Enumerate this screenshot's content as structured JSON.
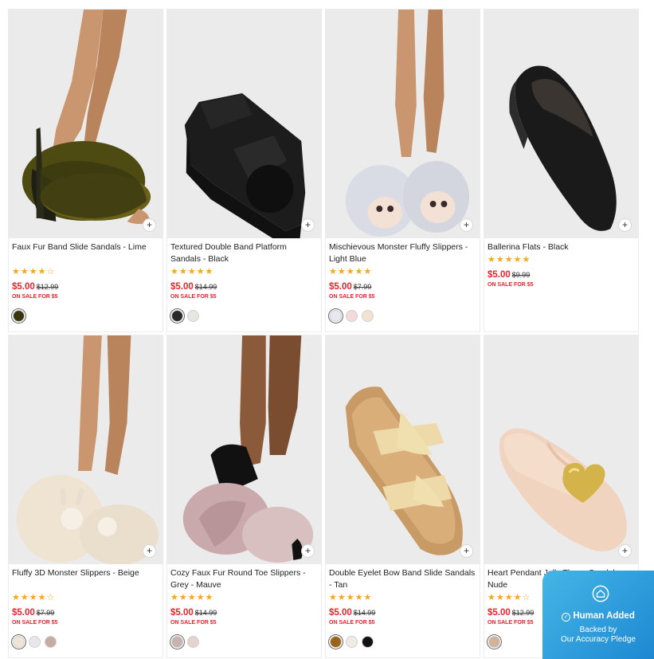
{
  "products": [
    {
      "name": "Faux Fur Band Slide Sandals - Lime",
      "rating": "★★★★☆",
      "price": "$5.00",
      "was": "$12.99",
      "sale": "ON SALE FOR $5",
      "swatches": [
        "#3a3410"
      ],
      "img": "furslide"
    },
    {
      "name": "Textured Double Band Platform Sandals - Black",
      "rating": "★★★★★",
      "price": "$5.00",
      "was": "$14.99",
      "sale": "ON SALE FOR $5",
      "swatches": [
        "#2a2a2a",
        "#e6e8e0"
      ],
      "img": "platform"
    },
    {
      "name": "Mischievous Monster Fluffy Slippers - Light Blue",
      "rating": "★★★★★",
      "price": "$5.00",
      "was": "$7.99",
      "sale": "ON SALE FOR $5",
      "swatches": [
        "#e6e9ef",
        "#f4d9d9",
        "#f1e3cf"
      ],
      "img": "monsterblue"
    },
    {
      "name": "Ballerina Flats - Black",
      "rating": "★★★★★",
      "price": "$5.00",
      "was": "$9.99",
      "sale": "ON SALE FOR $5",
      "swatches": [],
      "img": "flats"
    },
    {
      "name": "Fluffy 3D Monster Slippers - Beige",
      "rating": "★★★★☆",
      "price": "$5.00",
      "was": "$7.99",
      "sale": "ON SALE FOR $5",
      "swatches": [
        "#efe5d7",
        "#e8e6e8",
        "#c5ada3"
      ],
      "img": "monsterbeige"
    },
    {
      "name": "Cozy Faux Fur Round Toe Slippers - Grey - Mauve",
      "rating": "★★★★★",
      "price": "$5.00",
      "was": "$14.99",
      "sale": "ON SALE FOR $5",
      "swatches": [
        "#c7b2b0",
        "#e4d4cd"
      ],
      "img": "furmauve"
    },
    {
      "name": "Double Eyelet Bow Band Slide Sandals - Tan",
      "rating": "★★★★★",
      "price": "$5.00",
      "was": "$14.99",
      "sale": "ON SALE FOR $5",
      "swatches": [
        "#9a6318",
        "#f0ebe4",
        "#111111"
      ],
      "img": "bowslide"
    },
    {
      "name": "Heart Pendant Jelly Thong Sandals - Nude",
      "rating": "★★★★☆",
      "price": "$5.00",
      "was": "$12.99",
      "sale": "ON SALE FOR $5",
      "swatches": [
        "#d3b29a"
      ],
      "img": "jelly"
    }
  ],
  "badge": {
    "title": "Human Added",
    "line1": "Backed by",
    "line2": "Our Accuracy Pledge"
  },
  "add_button": "+"
}
